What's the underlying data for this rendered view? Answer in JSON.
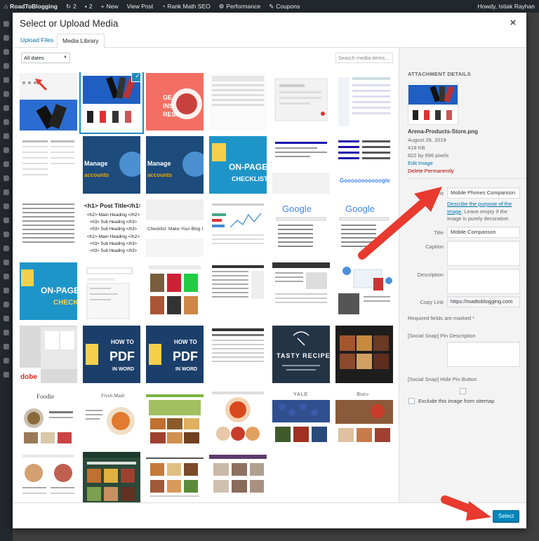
{
  "admin_bar": {
    "site": "RoadToBlogging",
    "updates": "2",
    "comments": "2",
    "new": "New",
    "view_post": "View Post",
    "rank_math": "Rank Math SEO",
    "performance": "Performance",
    "coupons": "Coupons",
    "howdy": "Howdy, Istiak Rayhan"
  },
  "modal": {
    "title": "Select or Upload Media",
    "close": "×",
    "tabs": [
      {
        "label": "Upload Files"
      },
      {
        "label": "Media Library"
      }
    ],
    "filter": "All dates",
    "search_placeholder": "Search media items..."
  },
  "attachment": {
    "heading": "ATTACHMENT DETAILS",
    "filename": "Arena-Products-Store.png",
    "date": "August 28, 2019",
    "size": "418 KB",
    "dimensions": "822 by 696 pixels",
    "edit_image": "Edit Image",
    "delete": "Delete Permanently",
    "alt_label": "Alt Text",
    "alt_value": "Mobile Phones Comparison",
    "help_link": "Describe the purpose of the image",
    "help_text": ". Leave empty if the image is purely decorative.",
    "title_label": "Title",
    "title_value": "Mobile Comparison",
    "caption_label": "Caption",
    "description_label": "Description",
    "copy_link_label": "Copy Link",
    "copy_link_value": "https://roadtoblogging.com",
    "required_text": "Required fields are marked",
    "required_star": "*",
    "pin_desc_label": "[Social Snap] Pin Description",
    "hide_pin_label": "[Social Snap] Hide Pin Button",
    "exclude_label": "Exclude this image from sitemap"
  },
  "thumb_text": {
    "seo_titles": "GE\nINS\nRESS",
    "manage": "Manage",
    "accounts": "accounts",
    "onpage": "ON-PAGE",
    "checklist": "CHECKLIST",
    "checke": "CHECKE",
    "heading_post": "<h1> Post Title</h1>",
    "h2": "<h2> Main Heading </h2>",
    "h3": "<h3> Sub Heading </h3>",
    "blog_check": "Checklist: Make Your Blog I",
    "google": "Google",
    "google_long": "Gooooooooooogle",
    "how_to": "HOW TO",
    "pdf": "PDF",
    "in_word": "IN WORD",
    "tasty": "TASTY RECIPES",
    "adobe": "dobe",
    "foodie": "Foodie",
    "fresh": "Fresh Made",
    "bistro": "Bistro",
    "yale": "YALE"
  },
  "footer": {
    "select": "Select"
  }
}
